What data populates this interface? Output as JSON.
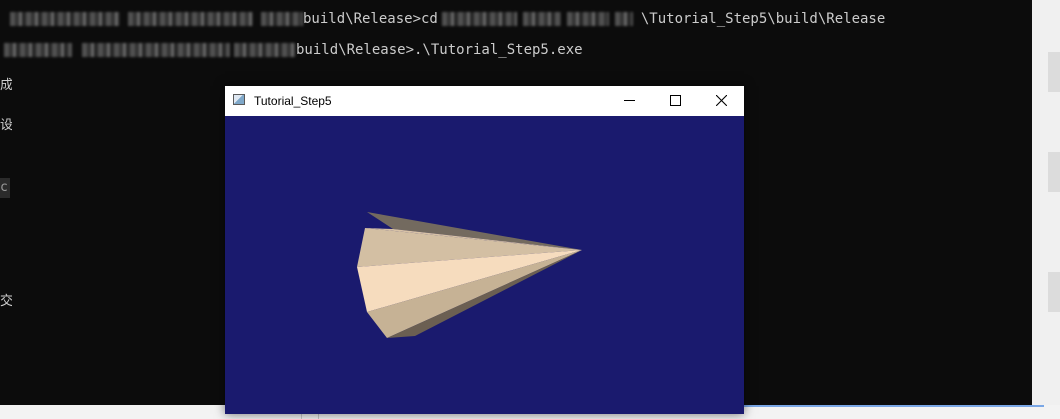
{
  "console": {
    "line1_suffix": "build\\Release>cd",
    "line1_tail": "\\Tutorial_Step5\\build\\Release",
    "line2_suffix": "build\\Release>.\\Tutorial_Step5.exe",
    "side_chars": [
      "成",
      "设",
      "c",
      "交"
    ]
  },
  "app_window": {
    "title": "Tutorial_Step5"
  },
  "icons": {
    "app": "app-window-icon",
    "minimize": "minimize-icon",
    "maximize": "maximize-icon",
    "close": "close-icon"
  },
  "colors": {
    "console_bg": "#0c0c0c",
    "console_text": "#cccccc",
    "render_bg": "#1a1a6e",
    "cone_light": "#f5dcbd",
    "cone_dark": "#6e6255"
  }
}
